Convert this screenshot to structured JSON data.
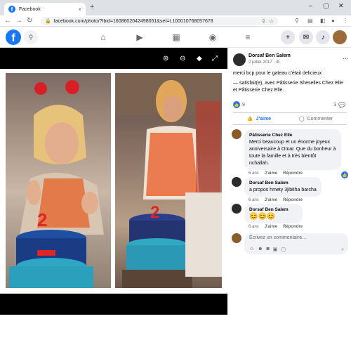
{
  "browser": {
    "tab_title": "Facebook",
    "tab_close": "×",
    "new_tab": "+",
    "url": "facebook.com/photo/?fbid=1608602042498051&set=t.100010768057678",
    "minimize": "–",
    "maximize": "▢",
    "close": "✕"
  },
  "fb": {
    "logo": "f"
  },
  "post": {
    "author": "Dorsaf Ben Salem",
    "date": "2 juillet 2017 · ⚙",
    "text": "merci bcp pour le gateau c'était delicieux",
    "tagline": "— satisfait(e), avec Pâtisserie Sheselles Chez Elle et Pâtisserie Chez Elle.",
    "likes": "9",
    "comments_count": "3"
  },
  "actions": {
    "like": "J'aime",
    "comment": "Commenter"
  },
  "comments": [
    {
      "name": "Pâtisserie Chez Elle",
      "text": "Merci beaucoup et un énorme joyeux anniversaire à Omar. Que du bonheur à toute la famille et à très bientôt nchallah.",
      "time": "6 ans",
      "like": "J'aime",
      "reply": "Répondre"
    },
    {
      "name": "Dorsaf Ben Salem",
      "text": "a propos hmety 3jibitha barcha",
      "time": "6 ans",
      "like": "J'aime",
      "reply": "Répondre"
    },
    {
      "name": "Dorsaf Ben Salem",
      "text": "😊😊😊",
      "time": "6 ans",
      "like": "J'aime",
      "reply": "Répondre"
    }
  ],
  "composer": {
    "placeholder": "Écrivez un commentaire…"
  }
}
